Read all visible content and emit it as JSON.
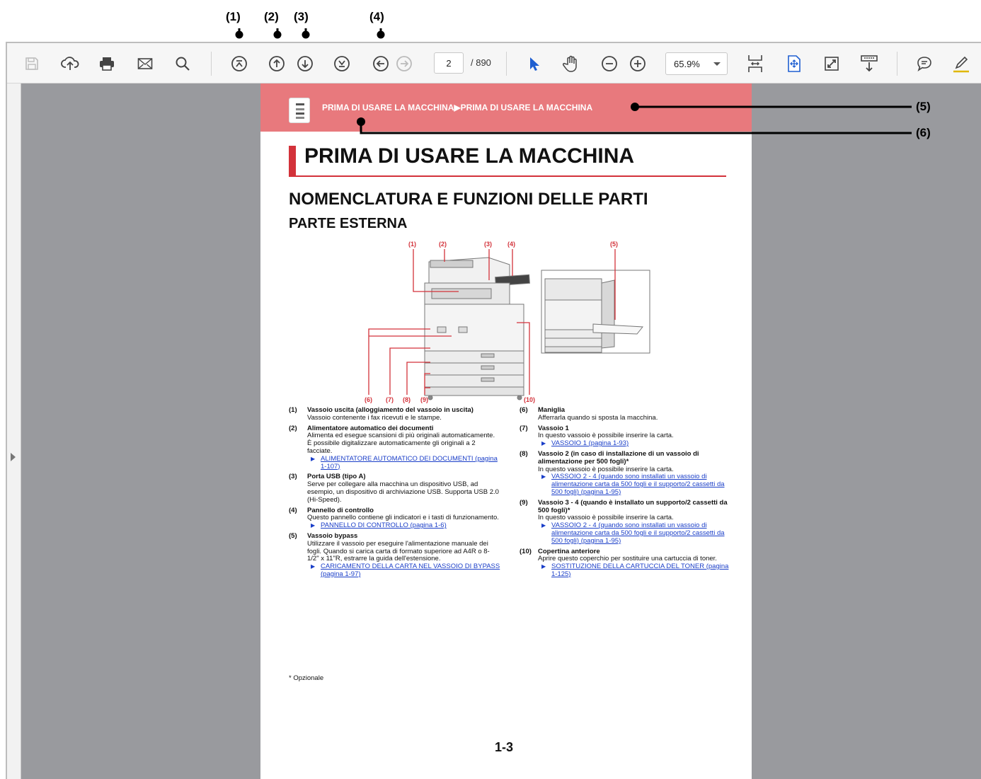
{
  "callouts": {
    "c1": "(1)",
    "c2": "(2)",
    "c3": "(3)",
    "c4": "(4)",
    "c5": "(5)",
    "c6": "(6)"
  },
  "toolbar": {
    "page_current": "2",
    "page_total": "/ 890",
    "zoom": "65.9%",
    "icons": [
      "save-icon",
      "upload-icon",
      "print-icon",
      "email-icon",
      "search-icon",
      "first-page-icon",
      "previous-page-icon",
      "next-page-icon",
      "last-page-icon",
      "previous-view-icon",
      "next-view-icon",
      "select-icon",
      "hand-icon",
      "zoom-out-icon",
      "zoom-in-icon",
      "fit-page-icon",
      "fit-width-icon",
      "full-screen-icon",
      "scroll-mode-icon",
      "comment-icon",
      "highlight-icon"
    ]
  },
  "page": {
    "banner": "PRIMA DI USARE LA MACCHINA▶PRIMA DI USARE LA MACCHINA",
    "title": "PRIMA DI USARE LA MACCHINA",
    "section": "NOMENCLATURA E FUNZIONI DELLE PARTI",
    "subsection": "PARTE ESTERNA",
    "figure_labels": {
      "l1": "(1)",
      "l2": "(2)",
      "l3": "(3)",
      "l4": "(4)",
      "l5": "(5)",
      "l6": "(6)",
      "l7": "(7)",
      "l8": "(8)",
      "l9": "(9)",
      "l10": "(10)"
    },
    "items": {
      "i1": {
        "num": "(1)",
        "title": "Vassoio uscita (alloggiamento del vassoio in uscita)",
        "desc": "Vassoio contenente i fax ricevuti e le stampe."
      },
      "i2": {
        "num": "(2)",
        "title": "Alimentatore automatico dei documenti",
        "desc": "Alimenta ed esegue scansioni di più originali automaticamente. È possibile digitalizzare automaticamente gli originali a 2 facciate.",
        "link": "ALIMENTATORE AUTOMATICO DEI DOCUMENTI (pagina 1-107)"
      },
      "i3": {
        "num": "(3)",
        "title": "Porta USB (tipo A)",
        "desc": "Serve per collegare alla macchina un dispositivo USB, ad esempio, un dispositivo di archiviazione USB. Supporta USB 2.0 (Hi-Speed)."
      },
      "i4": {
        "num": "(4)",
        "title": "Pannello di controllo",
        "desc": "Questo pannello contiene gli indicatori e i tasti di funzionamento.",
        "link": "PANNELLO DI CONTROLLO (pagina 1-6)"
      },
      "i5": {
        "num": "(5)",
        "title": "Vassoio bypass",
        "desc": "Utilizzare il vassoio per eseguire l'alimentazione manuale dei fogli. Quando si carica carta di formato superiore ad A4R o 8-1/2\" x 11\"R, estrarre la guida dell'estensione.",
        "link": "CARICAMENTO DELLA CARTA NEL VASSOIO DI BYPASS (pagina 1-97)"
      },
      "i6": {
        "num": "(6)",
        "title": "Maniglia",
        "desc": "Afferrarla quando si sposta la macchina."
      },
      "i7": {
        "num": "(7)",
        "title": "Vassoio 1",
        "desc": "In questo vassoio è possibile inserire la carta.",
        "link": "VASSOIO 1 (pagina 1-93)"
      },
      "i8": {
        "num": "(8)",
        "title": "Vassoio 2 (in caso di installazione di un vassoio di alimentazione per 500 fogli)*",
        "desc": "In questo vassoio è possibile inserire la carta.",
        "link": "VASSOIO 2 - 4 (quando sono installati un vassoio di alimentazione carta da 500 fogli e il supporto/2 cassetti da 500 fogli) (pagina 1-95)"
      },
      "i9": {
        "num": "(9)",
        "title": "Vassoio 3 - 4 (quando è installato un supporto/2 cassetti da 500 fogli)*",
        "desc": "In questo vassoio è possibile inserire la carta.",
        "link": "VASSOIO 2 - 4 (quando sono installati un vassoio di alimentazione carta da 500 fogli e il supporto/2 cassetti da 500 fogli) (pagina 1-95)"
      },
      "i10": {
        "num": "(10)",
        "title": "Copertina anteriore",
        "desc": "Aprire questo coperchio per sostituire una cartuccia di toner.",
        "link": "SOSTITUZIONE DELLA CARTUCCIA DEL TONER (pagina 1-125)"
      }
    },
    "footnote": "*   Opzionale",
    "page_number": "1-3"
  }
}
